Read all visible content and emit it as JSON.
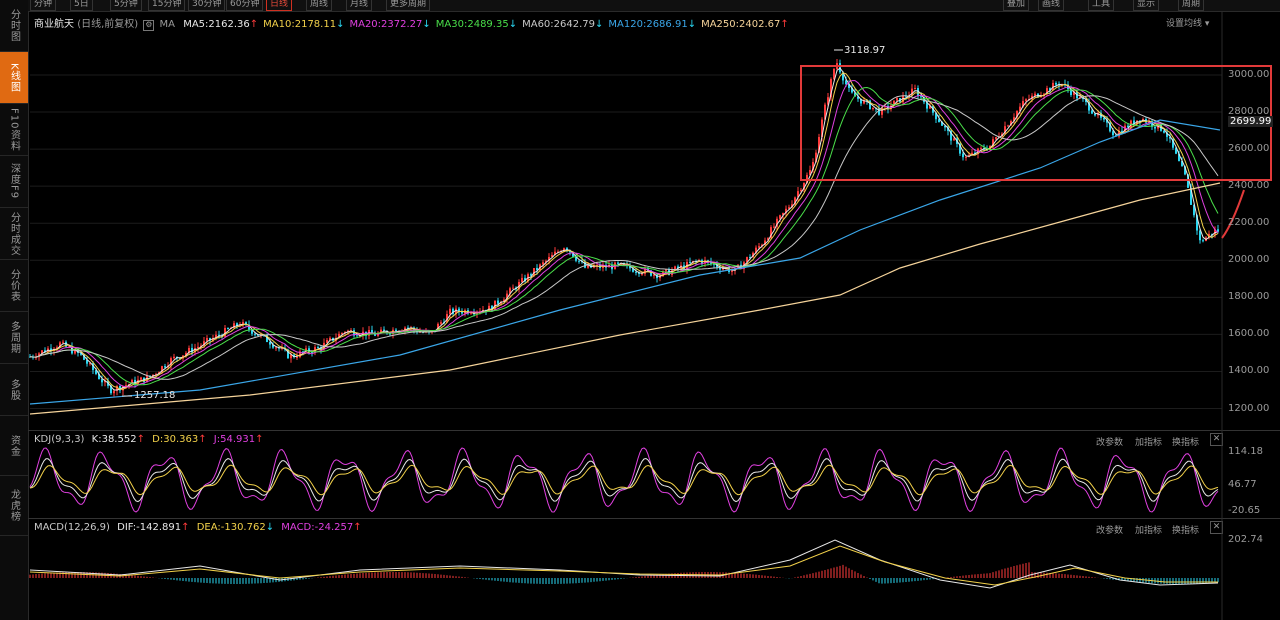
{
  "sidebar": {
    "items": [
      {
        "label": "分时图",
        "active": false
      },
      {
        "label": "K线图",
        "active": true
      },
      {
        "label": "F10资料",
        "active": false
      },
      {
        "label": "深度F9",
        "active": false
      },
      {
        "label": "分时成交",
        "active": false
      },
      {
        "label": "分价表",
        "active": false
      },
      {
        "label": "多周期",
        "active": false
      },
      {
        "label": "多股",
        "active": false
      },
      {
        "label": "资金",
        "active": false
      },
      {
        "label": "龙虎榜",
        "active": false
      }
    ]
  },
  "toolbar": {
    "buttons": [
      "分钟",
      "5日",
      "5分钟",
      "15分钟",
      "30分钟",
      "60分钟",
      "日线",
      "周线",
      "月线",
      "更多周期"
    ],
    "active": "日线",
    "right_buttons": [
      "叠加",
      "画线",
      "工具",
      "显示",
      "周期"
    ]
  },
  "main_legend": {
    "stock": "商业航天",
    "adjust": "(日线,前复权)",
    "ma": "MA",
    "items": [
      {
        "label": "MA5:2162.36",
        "arrow": "↑",
        "color": "#e8e8e8"
      },
      {
        "label": "MA10:2178.11",
        "arrow": "↓",
        "color": "#f2d14a"
      },
      {
        "label": "MA20:2372.27",
        "arrow": "↓",
        "color": "#e040e0"
      },
      {
        "label": "MA30:2489.35",
        "arrow": "↓",
        "color": "#4adf4a"
      },
      {
        "label": "MA60:2642.79",
        "arrow": "↓",
        "color": "#c8c8c8"
      },
      {
        "label": "MA120:2686.91",
        "arrow": "↓",
        "color": "#3aa6e8"
      },
      {
        "label": "MA250:2402.67",
        "arrow": "↑",
        "color": "#f5d39a"
      }
    ],
    "settings": "设置均线"
  },
  "price_axis": [
    "3000.00",
    "2800.00",
    "2600.00",
    "2400.00",
    "2200.00",
    "2000.00",
    "1800.00",
    "1600.00",
    "1400.00",
    "1200.00"
  ],
  "current_price": "2699.99",
  "high_label": "3118.97",
  "low_label": "1257.18",
  "kdj": {
    "name": "KDJ(9,3,3)",
    "k": "K:38.552",
    "k_arrow": "↑",
    "d": "D:30.363",
    "d_arrow": "↑",
    "j": "J:54.931",
    "j_arrow": "↑",
    "axis": [
      "114.18",
      "46.77",
      "-20.65"
    ]
  },
  "macd": {
    "name": "MACD(12,26,9)",
    "dif": "DIF:-142.891",
    "dif_arrow": "↑",
    "dea": "DEA:-130.762",
    "dea_arrow": "↓",
    "macd": "MACD:-24.257",
    "macd_arrow": "↑",
    "axis": [
      "202.74"
    ]
  },
  "indicator_buttons": {
    "params": "改参数",
    "add": "加指标",
    "switch": "换指标"
  },
  "colors": {
    "up": "#ff3b3b",
    "down": "#2ad6f0",
    "highlight_box": "#e23a3a",
    "active_tab": "#e06a12"
  }
}
